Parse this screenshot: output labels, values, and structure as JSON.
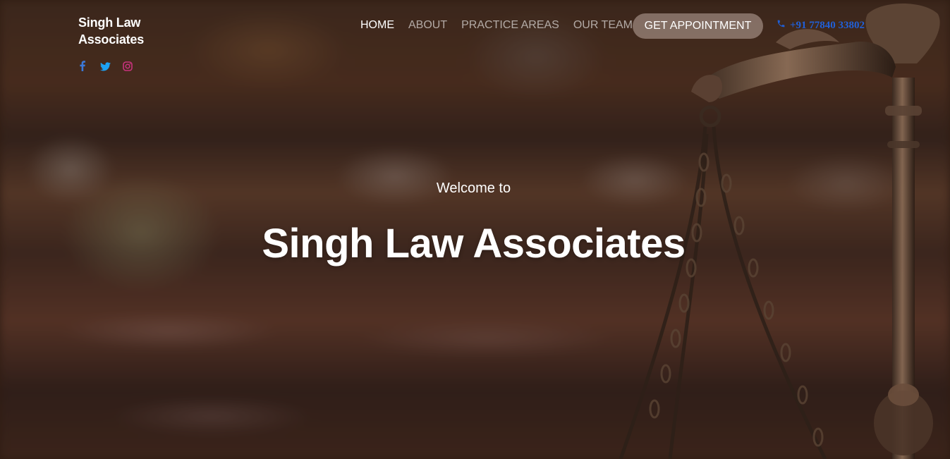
{
  "brand": {
    "name": "Singh Law Associates"
  },
  "social": {
    "facebook": "facebook-icon",
    "twitter": "twitter-icon",
    "instagram": "instagram-icon",
    "colors": {
      "facebook": "#3b78d8",
      "twitter": "#1da1f2",
      "instagram": "#c8337d"
    }
  },
  "nav": {
    "items": [
      {
        "label": "HOME",
        "active": true
      },
      {
        "label": "ABOUT",
        "active": false
      },
      {
        "label": "PRACTICE AREAS",
        "active": false
      },
      {
        "label": "OUR TEAM",
        "active": false
      }
    ],
    "cta_label": "GET APPOINTMENT",
    "phone": "+91 77840 33802",
    "phone_icon": "phone-icon"
  },
  "hero": {
    "welcome": "Welcome to",
    "title": "Singh Law Associates",
    "background": "blurred law office with scales of justice"
  },
  "colors": {
    "nav_active": "#ffffff",
    "nav_inactive": "#bfb3ad",
    "cta_bg": "#9c8a82",
    "phone": "#1f5fd6"
  }
}
